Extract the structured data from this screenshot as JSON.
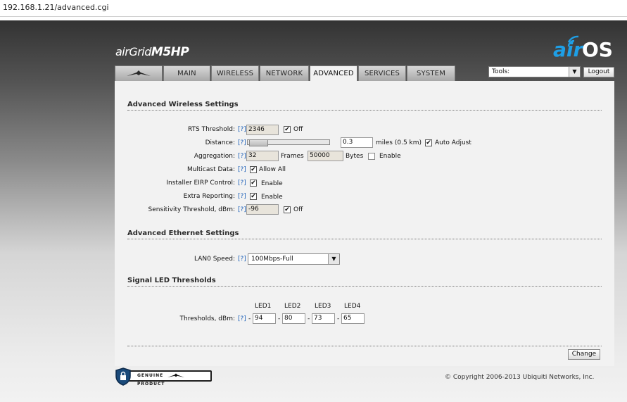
{
  "browser": {
    "url": "192.168.1.21/advanced.cgi"
  },
  "brand": {
    "product_prefix": "airGrid",
    "product_model": "M5HP",
    "os_air": "air",
    "os_os": "OS"
  },
  "tabs": [
    "MAIN",
    "WIRELESS",
    "NETWORK",
    "ADVANCED",
    "SERVICES",
    "SYSTEM"
  ],
  "active_tab": "ADVANCED",
  "tools": {
    "label": "Tools:",
    "logout": "Logout"
  },
  "help_text": "[?]",
  "advanced_wireless": {
    "title": "Advanced Wireless Settings",
    "rts": {
      "label": "RTS Threshold:",
      "value": "2346",
      "off_label": "Off",
      "off_checked": true
    },
    "distance": {
      "label": "Distance:",
      "value": "0.3",
      "unit": "miles (0.5 km)",
      "auto_label": "Auto Adjust",
      "auto_checked": true,
      "slider_position": 0.05
    },
    "aggregation": {
      "label": "Aggregation:",
      "frames_value": "32",
      "frames_label": "Frames",
      "bytes_value": "50000",
      "bytes_label": "Bytes",
      "enable_label": "Enable",
      "enable_checked": false
    },
    "multicast": {
      "label": "Multicast Data:",
      "allow_label": "Allow All",
      "checked": true
    },
    "installer_eirp": {
      "label": "Installer EIRP Control:",
      "enable_label": "Enable",
      "checked": true
    },
    "extra_reporting": {
      "label": "Extra Reporting:",
      "enable_label": "Enable",
      "checked": true
    },
    "sensitivity": {
      "label": "Sensitivity Threshold, dBm:",
      "value": "-96",
      "off_label": "Off",
      "off_checked": true
    }
  },
  "advanced_ethernet": {
    "title": "Advanced Ethernet Settings",
    "lan0": {
      "label": "LAN0 Speed:",
      "value": "100Mbps-Full"
    }
  },
  "signal_led": {
    "title": "Signal LED Thresholds",
    "label": "Thresholds, dBm:",
    "leds": [
      {
        "name": "LED1",
        "value": "94"
      },
      {
        "name": "LED2",
        "value": "80"
      },
      {
        "name": "LED3",
        "value": "73"
      },
      {
        "name": "LED4",
        "value": "65"
      }
    ],
    "separator": "-"
  },
  "change_button": "Change",
  "footer": {
    "badge_left": "GENUINE",
    "badge_right": "PRODUCT",
    "copyright": "© Copyright 2006-2013 Ubiquiti Networks, Inc."
  }
}
